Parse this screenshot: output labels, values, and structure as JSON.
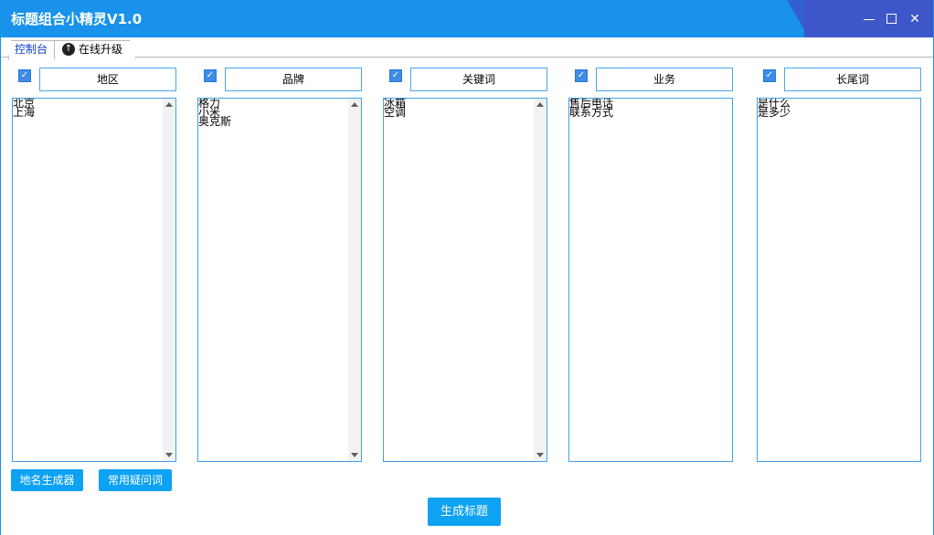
{
  "window": {
    "title": "标题组合小精灵V1.0"
  },
  "tabs": [
    {
      "label": "控制台"
    },
    {
      "label": "在线升级",
      "icon": "arrow-up-circle-icon"
    }
  ],
  "columns": [
    {
      "checked": true,
      "header": "地区",
      "lines": [
        "北京",
        "上海"
      ],
      "scrollbar": true
    },
    {
      "checked": true,
      "header": "品牌",
      "lines": [
        "格力",
        "小米",
        "奥克斯"
      ],
      "scrollbar": true
    },
    {
      "checked": true,
      "header": "关键词",
      "lines": [
        "冰箱",
        "空调"
      ],
      "scrollbar": true
    },
    {
      "checked": true,
      "header": "业务",
      "lines": [
        "售后电话",
        "联系方式"
      ],
      "scrollbar": false
    },
    {
      "checked": true,
      "header": "长尾词",
      "lines": [
        "是什么",
        "是多少"
      ],
      "scrollbar": false
    }
  ],
  "buttons": {
    "place_generator": "地名生成器",
    "common_questions": "常用疑问词",
    "generate": "生成标题"
  },
  "colors": {
    "titlebar": "#1892ea",
    "button": "#0ea2f3",
    "border": "#41a3e6",
    "checkbox": "#3e8ce8"
  }
}
